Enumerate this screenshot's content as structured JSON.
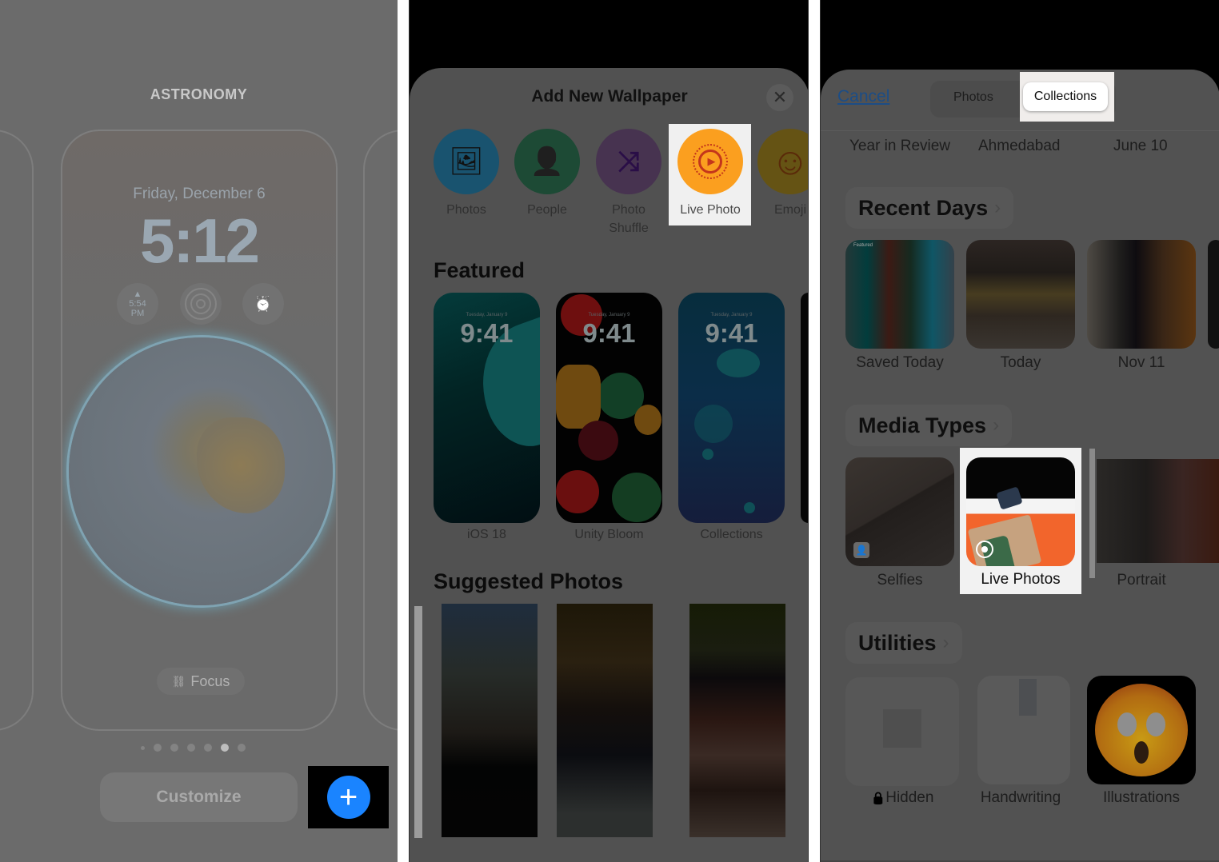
{
  "panel1": {
    "title": "ASTRONOMY",
    "lock_date": "Friday, December 6",
    "lock_time": "5:12",
    "widgets": [
      {
        "icon": "sunset-icon",
        "text": "5:54",
        "subtext": "PM"
      },
      {
        "icon": "activity-rings-icon"
      },
      {
        "icon": "alarm-clock-icon",
        "glyph": "⏰"
      }
    ],
    "focus_label": "Focus",
    "focus_icon": "🔗",
    "page_dots": {
      "count": 7,
      "active_index": 5
    },
    "customize_label": "Customize",
    "add_button_glyph": "+",
    "colors": {
      "accent": "#1a84ff",
      "dim_bg": "#6b6b6b"
    }
  },
  "panel2": {
    "sheet_title": "Add New Wallpaper",
    "close_glyph": "✕",
    "categories": [
      {
        "label": "Photos",
        "icon": "photos-icon",
        "glyph": "🖼"
      },
      {
        "label": "People",
        "icon": "person-icon",
        "glyph": "👤"
      },
      {
        "label": "Photo Shuffle",
        "icon": "shuffle-icon",
        "glyph": "⤨"
      },
      {
        "label": "Live Photo",
        "icon": "live-photo-icon",
        "glyph": "▶",
        "highlighted": true
      },
      {
        "label": "Emoji",
        "icon": "emoji-icon",
        "glyph": "☺"
      }
    ],
    "featured_heading": "Featured",
    "featured": [
      {
        "label": "iOS 18",
        "time": "9:41",
        "date": "Tuesday, January 9"
      },
      {
        "label": "Unity Bloom",
        "time": "9:41",
        "date": "Tuesday, January 9"
      },
      {
        "label": "Collections",
        "time": "9:41",
        "date": "Tuesday, January 9"
      }
    ],
    "suggested_heading": "Suggested Photos",
    "highlight_color": "#fb9f1f"
  },
  "panel3": {
    "cancel_label": "Cancel",
    "tabs": [
      {
        "label": "Photos",
        "selected": false
      },
      {
        "label": "Collections",
        "selected": true
      }
    ],
    "memories": [
      "Year in Review",
      "Ahmedabad",
      "June 10"
    ],
    "sections": [
      {
        "heading": "Recent Days",
        "items": [
          {
            "label": "Saved Today",
            "badge": "Featured"
          },
          {
            "label": "Today"
          },
          {
            "label": "Nov 11"
          }
        ]
      },
      {
        "heading": "Media Types",
        "items": [
          {
            "label": "Selfies",
            "icon": "selfie-icon"
          },
          {
            "label": "Live Photos",
            "icon": "live-photo-icon",
            "highlighted": true
          },
          {
            "label": "Portrait"
          }
        ]
      },
      {
        "heading": "Utilities",
        "items": [
          {
            "label": "Hidden",
            "icon": "lock-icon",
            "glyph": "🔒"
          },
          {
            "label": "Handwriting"
          },
          {
            "label": "Illustrations"
          }
        ]
      }
    ],
    "chevron_glyph": "›"
  }
}
